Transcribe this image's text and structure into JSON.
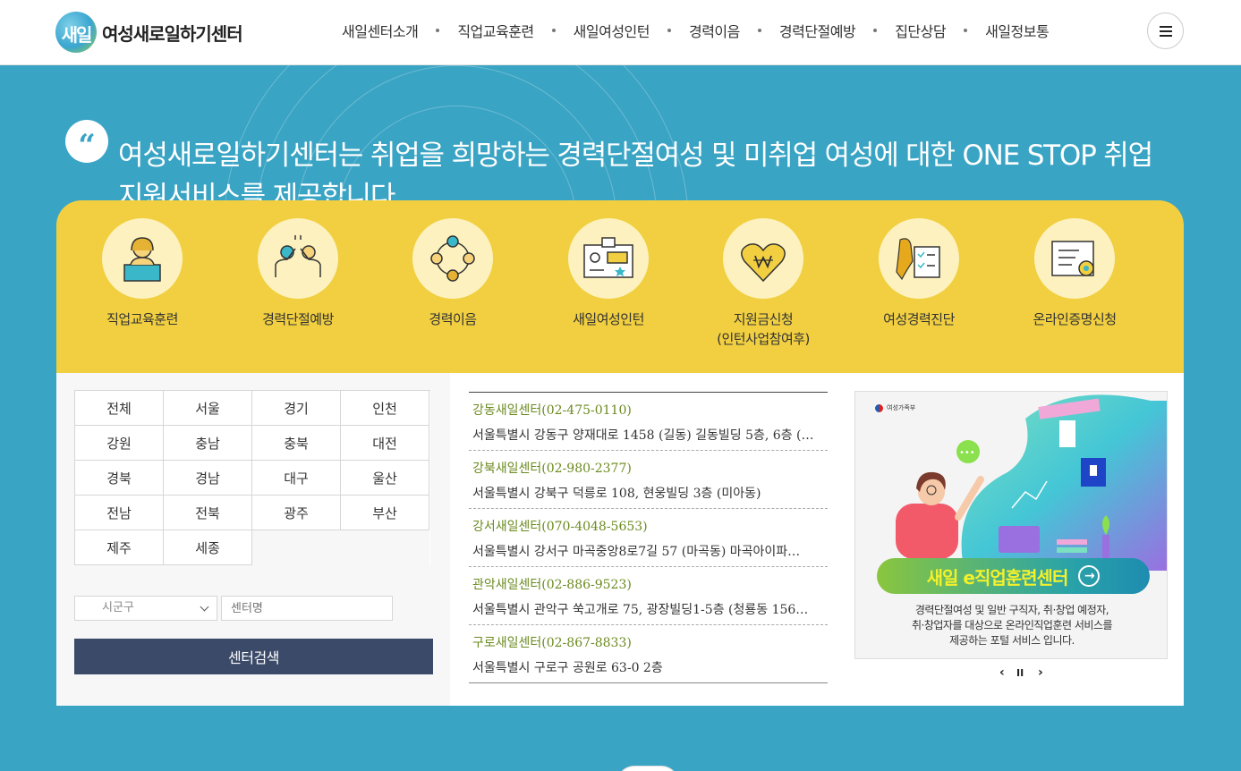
{
  "header": {
    "logo_mark": "새일",
    "logo_text": "여성새로일하기센터",
    "nav": [
      "새일센터소개",
      "직업교육훈련",
      "새일여성인턴",
      "경력이음",
      "경력단절예방",
      "집단상담",
      "새일정보통"
    ]
  },
  "hero": {
    "quote_mark": "“",
    "message_line1": "여성새로일하기센터는 취업을 희망하는 경력단절여성 및 미취업 여성에 대한 ONE STOP 취업",
    "message_line2": "지원서비스를 제공합니다."
  },
  "quick_menu": [
    {
      "label": "직업교육훈련",
      "sub": "",
      "icon": "teacher-icon"
    },
    {
      "label": "경력단절예방",
      "sub": "",
      "icon": "high-five-icon"
    },
    {
      "label": "경력이음",
      "sub": "",
      "icon": "connected-people-icon"
    },
    {
      "label": "새일여성인턴",
      "sub": "",
      "icon": "id-card-icon"
    },
    {
      "label": "지원금신청",
      "sub": "(인턴사업참여후)",
      "icon": "won-heart-icon"
    },
    {
      "label": "여성경력진단",
      "sub": "",
      "icon": "checklist-map-icon"
    },
    {
      "label": "온라인증명신청",
      "sub": "",
      "icon": "certificate-icon"
    }
  ],
  "regions": [
    "전체",
    "서울",
    "경기",
    "인천",
    "강원",
    "충남",
    "충북",
    "대전",
    "경북",
    "경남",
    "대구",
    "울산",
    "전남",
    "전북",
    "광주",
    "부산",
    "제주",
    "세종"
  ],
  "search": {
    "district_select": "시군구",
    "center_name_placeholder": "센터명",
    "button_label": "센터검색"
  },
  "centers": [
    {
      "name": "강동새일센터(02-475-0110)",
      "address": "서울특별시 강동구 양재대로 1458 (길동) 길동빌딩 5층, 6층 (…"
    },
    {
      "name": "강북새일센터(02-980-2377)",
      "address": "서울특별시 강북구 덕릉로 108, 현웅빌딩 3층 (미아동)"
    },
    {
      "name": "강서새일센터(070-4048-5653)",
      "address": "서울특별시 강서구 마곡중앙8로7길 57 (마곡동) 마곡아이파…"
    },
    {
      "name": "관악새일센터(02-886-9523)",
      "address": "서울특별시 관악구 쑥고개로 75, 광장빌딩1-5층 (청룡동 156…"
    },
    {
      "name": "구로새일센터(02-867-8833)",
      "address": "서울특별시 구로구 공원로 63-0 2층"
    }
  ],
  "banner": {
    "org_label": "여성가족부",
    "speech": "•••",
    "button_label": "새일 e직업훈련센터",
    "desc_line1": "경력단절여성 및 일반 구직자, 취·창업 예정자,",
    "desc_line2": "취·창업자를 대상으로 온라인직업훈련 서비스를",
    "desc_line3": "제공하는 포털 서비스 입니다.",
    "prev": "‹",
    "pause": "II",
    "next": "›"
  },
  "colors": {
    "hero_bg": "#3aa4c4",
    "quick_bg": "#f1cf40",
    "search_button": "#3b4a68",
    "center_name": "#6a8a1f"
  }
}
